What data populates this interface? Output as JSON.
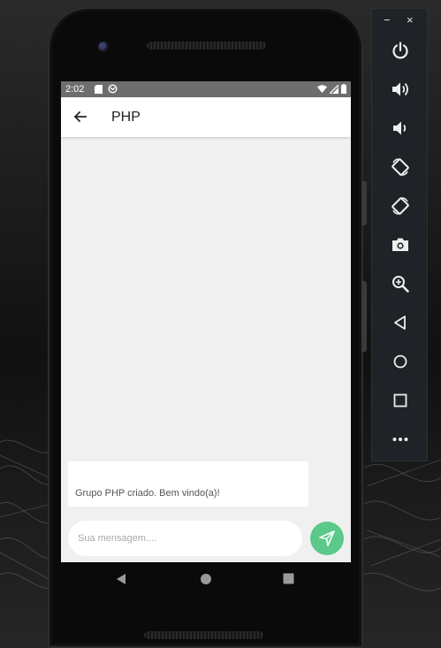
{
  "status_bar": {
    "time": "2:02",
    "left_icons": [
      "sd-card-icon",
      "sync-icon"
    ],
    "right_icons": [
      "wifi-icon",
      "signal-icon",
      "battery-icon"
    ]
  },
  "app_bar": {
    "title": "PHP",
    "back_icon": "arrow-left-icon"
  },
  "chat": {
    "messages": [
      {
        "text": "Grupo PHP criado. Bem vindo(a)!"
      }
    ]
  },
  "composer": {
    "placeholder": "Sua mensagem....",
    "value": "",
    "send_icon": "send-icon",
    "accent_color": "#5ac98a"
  },
  "android_nav": [
    "back-triangle-icon",
    "home-circle-icon",
    "recents-square-icon"
  ],
  "emulator_toolbar": {
    "window_controls": [
      "minimize-icon",
      "close-icon"
    ],
    "minimize_label": "−",
    "close_label": "×",
    "buttons": [
      "power-icon",
      "volume-up-icon",
      "volume-down-icon",
      "rotate-left-icon",
      "rotate-right-icon",
      "camera-icon",
      "zoom-icon",
      "back-icon",
      "home-icon",
      "overview-icon",
      "more-icon"
    ]
  },
  "colors": {
    "screen_background": "#f0f0f0",
    "status_bar": "#6e6e6e",
    "toolbar_background": "#1f2226",
    "send_button": "#5ac98a"
  }
}
